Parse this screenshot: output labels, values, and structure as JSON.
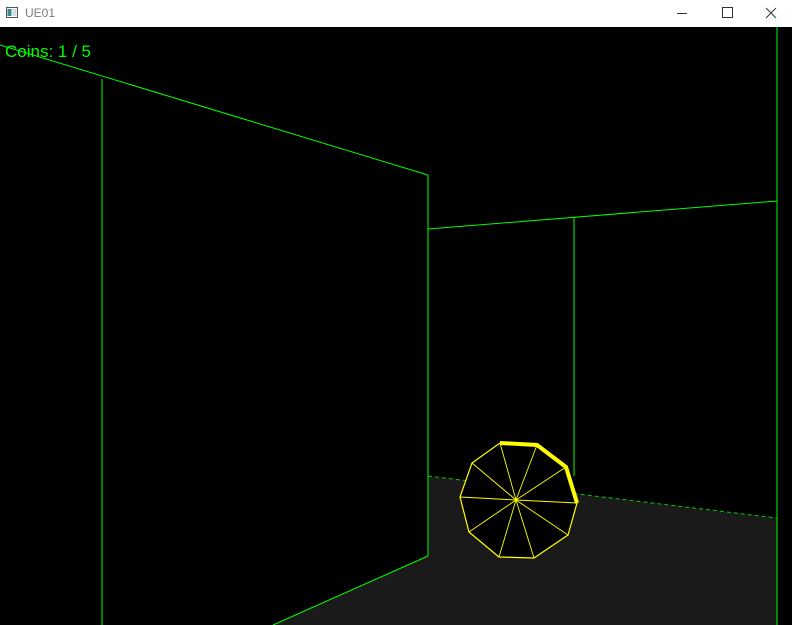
{
  "window": {
    "title": "UE01",
    "icon": "app-window-icon",
    "controls": [
      "minimize-icon",
      "maximize-icon",
      "close-icon"
    ]
  },
  "hud": {
    "coins_text": "Coins: 1 / 5",
    "coins_collected": 1,
    "coins_total": 5
  },
  "colors": {
    "background": "#000000",
    "wireframe": "#00ff00",
    "floor": "#1a1a1a",
    "coin": "#ffff00",
    "hud_text": "#00ff00",
    "titlebar": "#ffffff"
  }
}
